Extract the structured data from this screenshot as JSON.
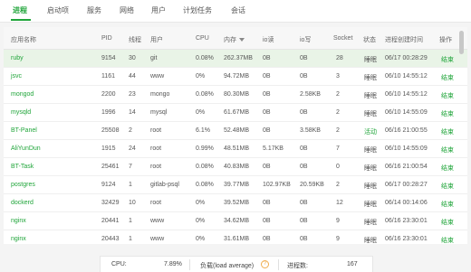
{
  "tabs": [
    {
      "label": "进程",
      "active": true
    },
    {
      "label": "启动项"
    },
    {
      "label": "服务"
    },
    {
      "label": "网络"
    },
    {
      "label": "用户"
    },
    {
      "label": "计划任务"
    },
    {
      "label": "会话"
    }
  ],
  "table": {
    "headers": {
      "name": "应用名称",
      "pid": "PID",
      "threads": "线程",
      "user": "用户",
      "cpu": "CPU",
      "mem": "内存",
      "io_read": "io读",
      "io_write": "io写",
      "socket": "Socket",
      "status": "状态",
      "created": "进程创建时间",
      "action": "操作"
    },
    "sort_column": "mem",
    "rows": [
      {
        "name": "ruby",
        "pid": "9154",
        "threads": "30",
        "user": "git",
        "cpu": "0.08%",
        "mem": "262.37MB",
        "io_read": "0B",
        "io_write": "0B",
        "socket": "28",
        "status": "睡眠",
        "created": "06/17 00:28:29",
        "action": "结束",
        "selected": true
      },
      {
        "name": "jsvc",
        "pid": "1161",
        "threads": "44",
        "user": "www",
        "cpu": "0%",
        "mem": "94.72MB",
        "io_read": "0B",
        "io_write": "0B",
        "socket": "3",
        "status": "睡眠",
        "created": "06/10 14:55:12",
        "action": "结束"
      },
      {
        "name": "mongod",
        "pid": "2200",
        "threads": "23",
        "user": "mongo",
        "cpu": "0.08%",
        "mem": "80.30MB",
        "io_read": "0B",
        "io_write": "2.58KB",
        "socket": "2",
        "status": "睡眠",
        "created": "06/10 14:55:12",
        "action": "结束"
      },
      {
        "name": "mysqld",
        "pid": "1996",
        "threads": "14",
        "user": "mysql",
        "cpu": "0%",
        "mem": "61.67MB",
        "io_read": "0B",
        "io_write": "0B",
        "socket": "2",
        "status": "睡眠",
        "created": "06/10 14:55:09",
        "action": "结束"
      },
      {
        "name": "BT-Panel",
        "pid": "25508",
        "threads": "2",
        "user": "root",
        "cpu": "6.1%",
        "mem": "52.48MB",
        "io_read": "0B",
        "io_write": "3.58KB",
        "socket": "2",
        "status": "活动",
        "created": "06/16 21:00:55",
        "action": "结束"
      },
      {
        "name": "AliYunDun",
        "pid": "1915",
        "threads": "24",
        "user": "root",
        "cpu": "0.99%",
        "mem": "48.51MB",
        "io_read": "5.17KB",
        "io_write": "0B",
        "socket": "7",
        "status": "睡眠",
        "created": "06/10 14:55:09",
        "action": "结束"
      },
      {
        "name": "BT-Task",
        "pid": "25461",
        "threads": "7",
        "user": "root",
        "cpu": "0.08%",
        "mem": "40.83MB",
        "io_read": "0B",
        "io_write": "0B",
        "socket": "0",
        "status": "睡眠",
        "created": "06/16 21:00:54",
        "action": "结束"
      },
      {
        "name": "postgres",
        "pid": "9124",
        "threads": "1",
        "user": "gitlab-psql",
        "cpu": "0.08%",
        "mem": "39.77MB",
        "io_read": "102.97KB",
        "io_write": "20.59KB",
        "socket": "2",
        "status": "睡眠",
        "created": "06/17 00:28:27",
        "action": "结束"
      },
      {
        "name": "dockerd",
        "pid": "32429",
        "threads": "10",
        "user": "root",
        "cpu": "0%",
        "mem": "39.52MB",
        "io_read": "0B",
        "io_write": "0B",
        "socket": "12",
        "status": "睡眠",
        "created": "06/14 00:14:06",
        "action": "结束"
      },
      {
        "name": "nginx",
        "pid": "20441",
        "threads": "1",
        "user": "www",
        "cpu": "0%",
        "mem": "34.62MB",
        "io_read": "0B",
        "io_write": "0B",
        "socket": "9",
        "status": "睡眠",
        "created": "06/16 23:30:01",
        "action": "结束"
      },
      {
        "name": "nginx",
        "pid": "20443",
        "threads": "1",
        "user": "www",
        "cpu": "0%",
        "mem": "31.61MB",
        "io_read": "0B",
        "io_write": "0B",
        "socket": "9",
        "status": "睡眠",
        "created": "06/16 23:30:01",
        "action": "结束"
      }
    ]
  },
  "footer": {
    "cpu_label": "CPU:",
    "cpu_value": "7.89%",
    "load_label": "负载(load average)",
    "proc_label": "进程数:",
    "proc_value": "167"
  },
  "colors": {
    "accent": "#20a53a",
    "selected_row": "#e9f4e7",
    "warning": "#f0ad4e"
  }
}
